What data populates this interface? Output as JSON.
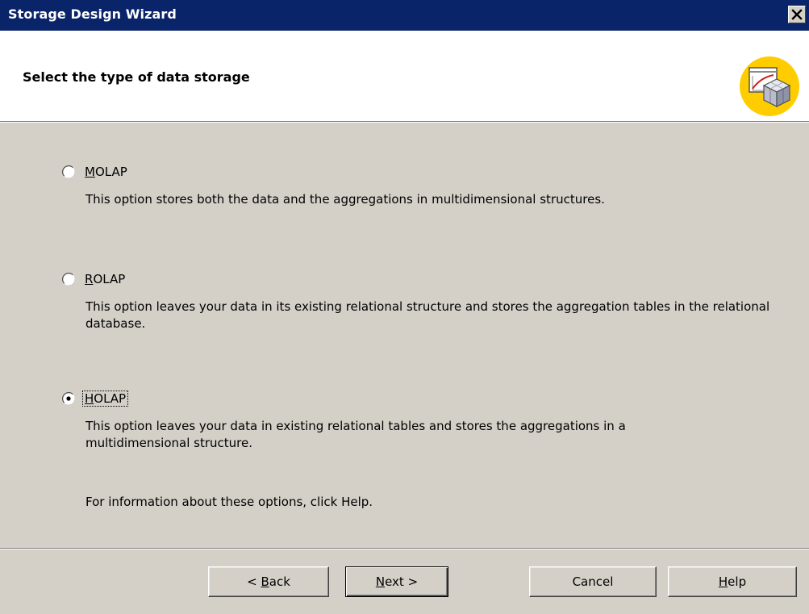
{
  "window": {
    "title": "Storage Design Wizard"
  },
  "header": {
    "title": "Select the type of data storage",
    "icon": "storage-cube-icon"
  },
  "options": [
    {
      "label": "MOLAP",
      "mnemonic": "M",
      "label_rest": "OLAP",
      "selected": false,
      "description": "This option stores both the data and the aggregations in multidimensional structures."
    },
    {
      "label": "ROLAP",
      "mnemonic": "R",
      "label_rest": "OLAP",
      "selected": false,
      "description": "This option leaves your data in its existing relational structure and stores the aggregation tables in the relational database."
    },
    {
      "label": "HOLAP",
      "mnemonic": "H",
      "label_rest": "OLAP",
      "selected": true,
      "description": "This option leaves your data in existing relational tables and stores the aggregations in a multidimensional structure."
    }
  ],
  "info_text": "For information about these options, click Help.",
  "buttons": {
    "back": {
      "pre": "< ",
      "mnemonic": "B",
      "post": "ack"
    },
    "next": {
      "mnemonic": "N",
      "post": "ext >"
    },
    "cancel": {
      "label": "Cancel"
    },
    "help": {
      "mnemonic": "H",
      "post": "elp"
    }
  },
  "colors": {
    "titlebar": "#0a246a",
    "dialog_bg": "#d4d0c8",
    "header_bg": "#ffffff",
    "icon_circle": "#ffcc00"
  }
}
